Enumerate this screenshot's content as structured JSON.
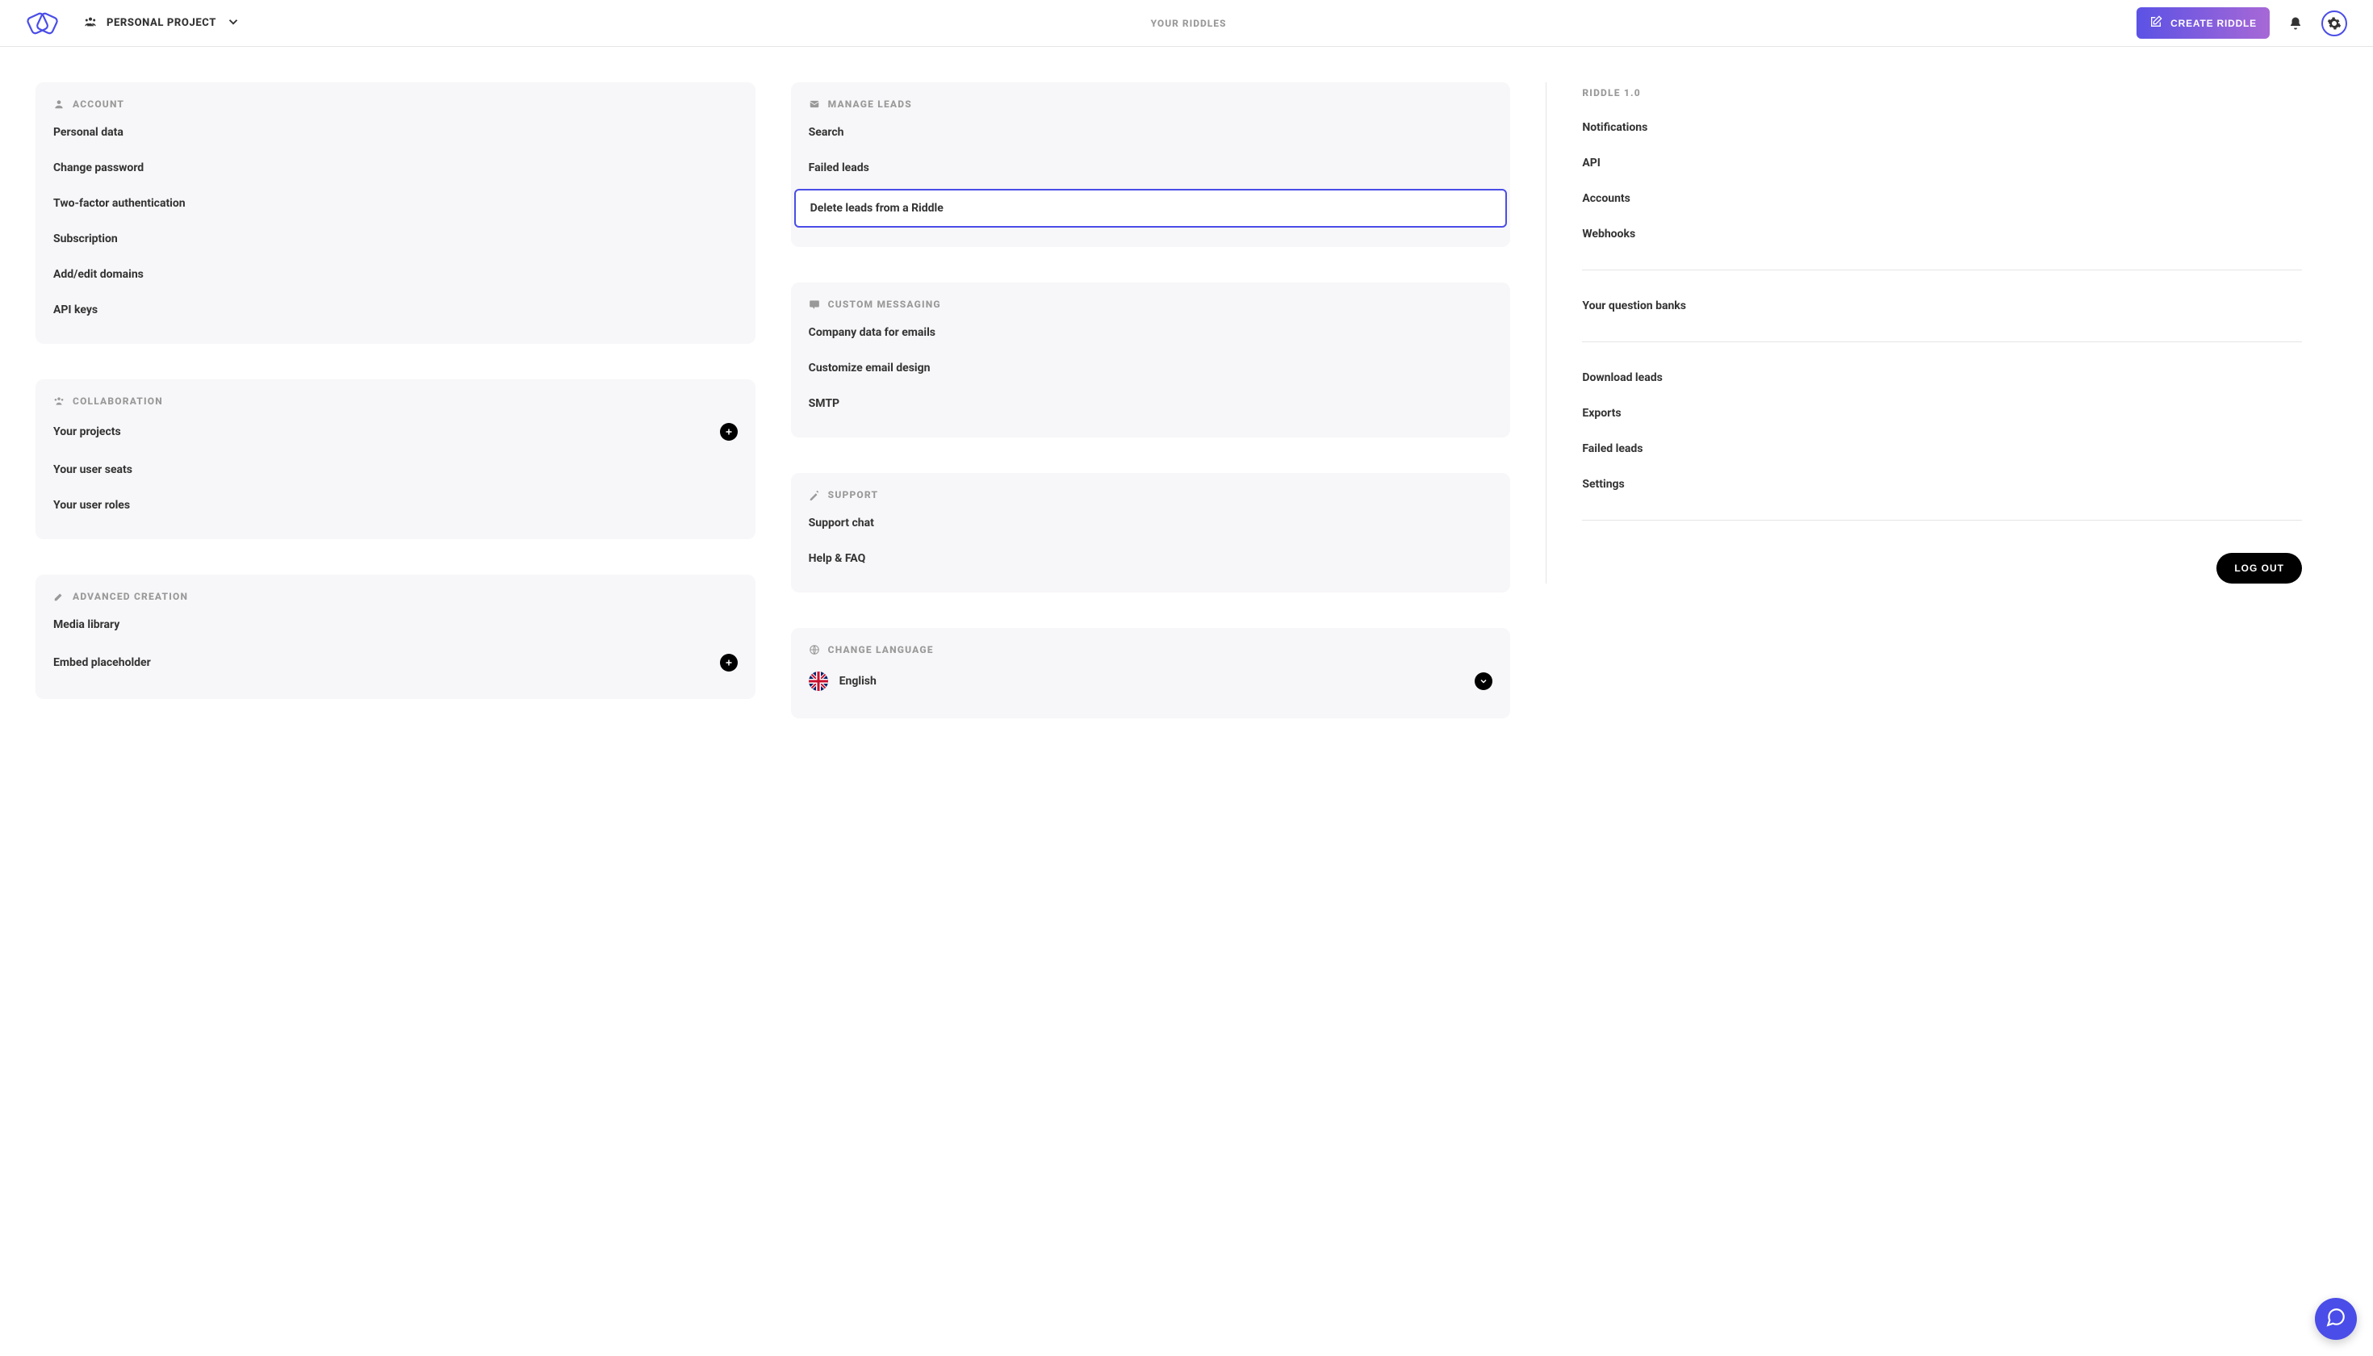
{
  "header": {
    "project_label": "PERSONAL PROJECT",
    "center_title": "YOUR RIDDLES",
    "create_label": "CREATE RIDDLE"
  },
  "cards": {
    "account": {
      "title": "ACCOUNT",
      "items": [
        {
          "label": "Personal data"
        },
        {
          "label": "Change password"
        },
        {
          "label": "Two-factor authentication"
        },
        {
          "label": "Subscription"
        },
        {
          "label": "Add/edit domains"
        },
        {
          "label": "API keys"
        }
      ]
    },
    "collaboration": {
      "title": "COLLABORATION",
      "items": [
        {
          "label": "Your projects",
          "plus": true
        },
        {
          "label": "Your user seats"
        },
        {
          "label": "Your user roles"
        }
      ]
    },
    "advanced": {
      "title": "ADVANCED CREATION",
      "items": [
        {
          "label": "Media library"
        },
        {
          "label": "Embed placeholder",
          "plus": true
        }
      ]
    },
    "leads": {
      "title": "MANAGE LEADS",
      "items": [
        {
          "label": "Search"
        },
        {
          "label": "Failed leads"
        },
        {
          "label": "Delete leads from a Riddle",
          "selected": true
        }
      ]
    },
    "messaging": {
      "title": "CUSTOM MESSAGING",
      "items": [
        {
          "label": "Company data for emails"
        },
        {
          "label": "Customize email design"
        },
        {
          "label": "SMTP"
        }
      ]
    },
    "support": {
      "title": "SUPPORT",
      "items": [
        {
          "label": "Support chat"
        },
        {
          "label": "Help & FAQ"
        }
      ]
    },
    "language": {
      "title": "CHANGE LANGUAGE",
      "selected": "English"
    }
  },
  "right": {
    "title": "RIDDLE 1.0",
    "group1": [
      {
        "label": "Notifications"
      },
      {
        "label": "API"
      },
      {
        "label": "Accounts"
      },
      {
        "label": "Webhooks"
      }
    ],
    "group2": [
      {
        "label": "Your question banks"
      }
    ],
    "group3": [
      {
        "label": "Download leads"
      },
      {
        "label": "Exports"
      },
      {
        "label": "Failed leads"
      },
      {
        "label": "Settings"
      }
    ],
    "logout": "LOG OUT"
  }
}
